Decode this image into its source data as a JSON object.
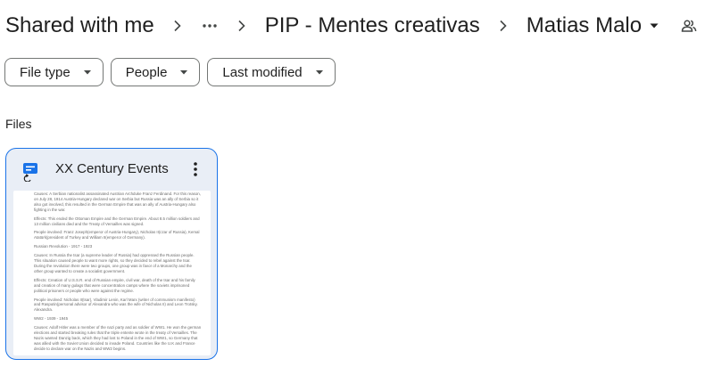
{
  "breadcrumb": {
    "root": "Shared with me",
    "more": "more-horizontal-icon",
    "folder": "PIP - Mentes creativas",
    "current": "Matias Malo"
  },
  "filters": [
    "File type",
    "People",
    "Last modified"
  ],
  "section_label": "Files",
  "file": {
    "title": "XX Century Events",
    "icon": "google-docs-icon",
    "accent": "#1a73e8",
    "preview": [
      "Causes: A Serbian nationalist assassinated Austrian Archduke Franz Ferdinand. For this reason, on July 28, 1914 Austria-Hungary declared war on Serbia but Russia was an ally of Serbia so it also got involved, this resulted in the German Empire that was an ally of Austria-Hungary also fighting in the war.",
      "Effects: This ended the Ottoman Empire and the German Empire. About 8.5 million soldiers and 13 million civilians died and the Treaty of Versailles was signed.",
      "People involved: Franz Joseph(emperor of Austria-Hungary), Nicholas II(czar of Russia), Kemal Atatürk(president of Turkey and William II(emperor of Germany).",
      "Russian Revolution - 1917 - 1923",
      "Causes: In Russia the tsar (a supreme leader of Russia) had oppressed the Russian people. This situation caused people to want more rights, so they decided to rebel against the tsar. During the revolution there were two groups, one group was in favor of a Monarchy and the other group wanted to create a socialist government.",
      "Effects: Creation of U.S.S.R. end of Russian empire, civil war, death of the tsar and his family and creation of many gulags that were concentration camps where the soviets imprisoned political prisoners or people who were against the regime.",
      "People involved: Nicholas II(tsar), Vladimir Lenin, Karl Marx (writer of communism manifesto) and Rasputin(personal advisor of Alexandra who was the wife of Nicholas II) and Leon Trotsky. Alexandra.",
      "WW2 - 1939 - 1945",
      "Causes: Adolf Hitler was a member of the nazi party and as soldier of WW1. He won the german elections and started breaking rules that the triple entente wrote in the treaty of Versailles. The Nazis wanted Danzig back, which they had lost to Poland in the end of WW1, so Germany that was allied with the Soviet Union decided to invade Poland. Countries like the U.K and France decide to declare war on the Nazis and WW2 begins."
    ]
  }
}
